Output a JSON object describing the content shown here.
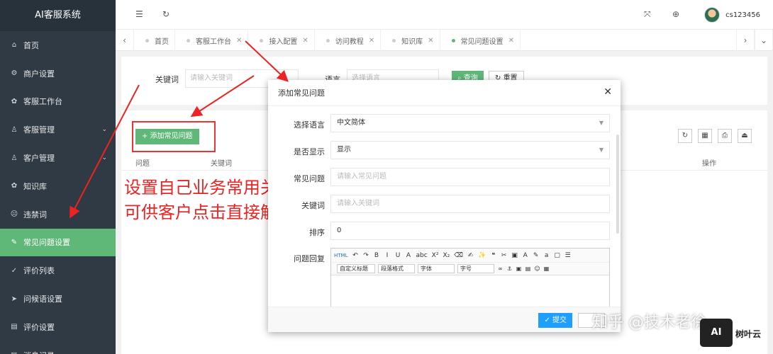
{
  "app": {
    "title": "AI客服系统"
  },
  "sidebar": {
    "items": [
      {
        "label": "首页",
        "icon": "home-icon",
        "glyph": "⌂"
      },
      {
        "label": "商户设置",
        "icon": "settings-icon",
        "glyph": "⚙"
      },
      {
        "label": "客服工作台",
        "icon": "workbench-icon",
        "glyph": "✿"
      },
      {
        "label": "客服管理",
        "icon": "user-icon",
        "glyph": "♙",
        "chevron": "⌄"
      },
      {
        "label": "客户管理",
        "icon": "customer-icon",
        "glyph": "♙",
        "chevron": "⌄"
      },
      {
        "label": "知识库",
        "icon": "knowledge-icon",
        "glyph": "✿"
      },
      {
        "label": "违禁词",
        "icon": "forbidden-icon",
        "glyph": "☹"
      },
      {
        "label": "常见问题设置",
        "icon": "faq-icon",
        "glyph": "✎",
        "active": true
      },
      {
        "label": "评价列表",
        "icon": "rating-icon",
        "glyph": "✓"
      },
      {
        "label": "问候语设置",
        "icon": "greeting-icon",
        "glyph": "➤"
      },
      {
        "label": "评价设置",
        "icon": "rating-settings-icon",
        "glyph": "▤"
      },
      {
        "label": "消息记录",
        "icon": "message-icon",
        "glyph": "✉"
      }
    ]
  },
  "header": {
    "menu_glyph": "☰",
    "refresh_glyph": "↻",
    "fullscreen_glyph": "⤧",
    "globe_glyph": "⊕",
    "username": "cs123456"
  },
  "tabs": {
    "prev_glyph": "‹",
    "next_glyph": "›",
    "more_glyph": "⌄",
    "items": [
      {
        "label": "首页",
        "close": ""
      },
      {
        "label": "客服工作台",
        "close": "✕"
      },
      {
        "label": "接入配置",
        "close": "✕"
      },
      {
        "label": "访问教程",
        "close": "✕"
      },
      {
        "label": "知识库",
        "close": "✕"
      },
      {
        "label": "常见问题设置",
        "close": "✕",
        "active": true
      }
    ]
  },
  "search": {
    "keyword_label": "关键词",
    "keyword_placeholder": "请输入关键词",
    "language_label": "语言",
    "language_placeholder": "选择语言",
    "search_button": "查询",
    "reset_button": "重置"
  },
  "table": {
    "add_button": "+ 添加常见问题",
    "columns": {
      "question": "问题",
      "keyword": "关键词",
      "action": "操作"
    },
    "tools": [
      "↻",
      "▦",
      "⎙",
      "⏏"
    ]
  },
  "annotation": {
    "line1": "设置自己业务常用关键词",
    "line2": "可供客户点击直接解答  便捷迅速"
  },
  "dialog": {
    "title": "添加常见问题",
    "close_glyph": "✕",
    "fields": {
      "language": {
        "label": "选择语言",
        "value": "中文简体",
        "caret": "▼"
      },
      "show": {
        "label": "是否显示",
        "value": "显示",
        "caret": "▼"
      },
      "question": {
        "label": "常见问题",
        "placeholder": "请输入常见问题"
      },
      "keyword": {
        "label": "关键词",
        "placeholder": "请输入关键词"
      },
      "sort": {
        "label": "排序",
        "value": "0"
      },
      "answer": {
        "label": "问题回复"
      }
    },
    "editor": {
      "toolbar1": [
        "HTML",
        "↶",
        "↷",
        "B",
        "I",
        "U",
        "A",
        "abc",
        "X²",
        "X₂",
        "⌫",
        "✍",
        "✨",
        "❝",
        "✂",
        "▣",
        "A",
        "✎",
        "a",
        "▢",
        "☰"
      ],
      "selects": [
        "自定义标题",
        "段落格式",
        "字体",
        "字号"
      ],
      "toolbar2": [
        "∞",
        "⚓",
        "▣",
        "▤",
        "☺",
        "▦"
      ]
    },
    "submit": "✓ 提交"
  },
  "watermark": {
    "text": "知乎 @技术老徐",
    "logo": "AI",
    "logo_name": "树叶云"
  }
}
